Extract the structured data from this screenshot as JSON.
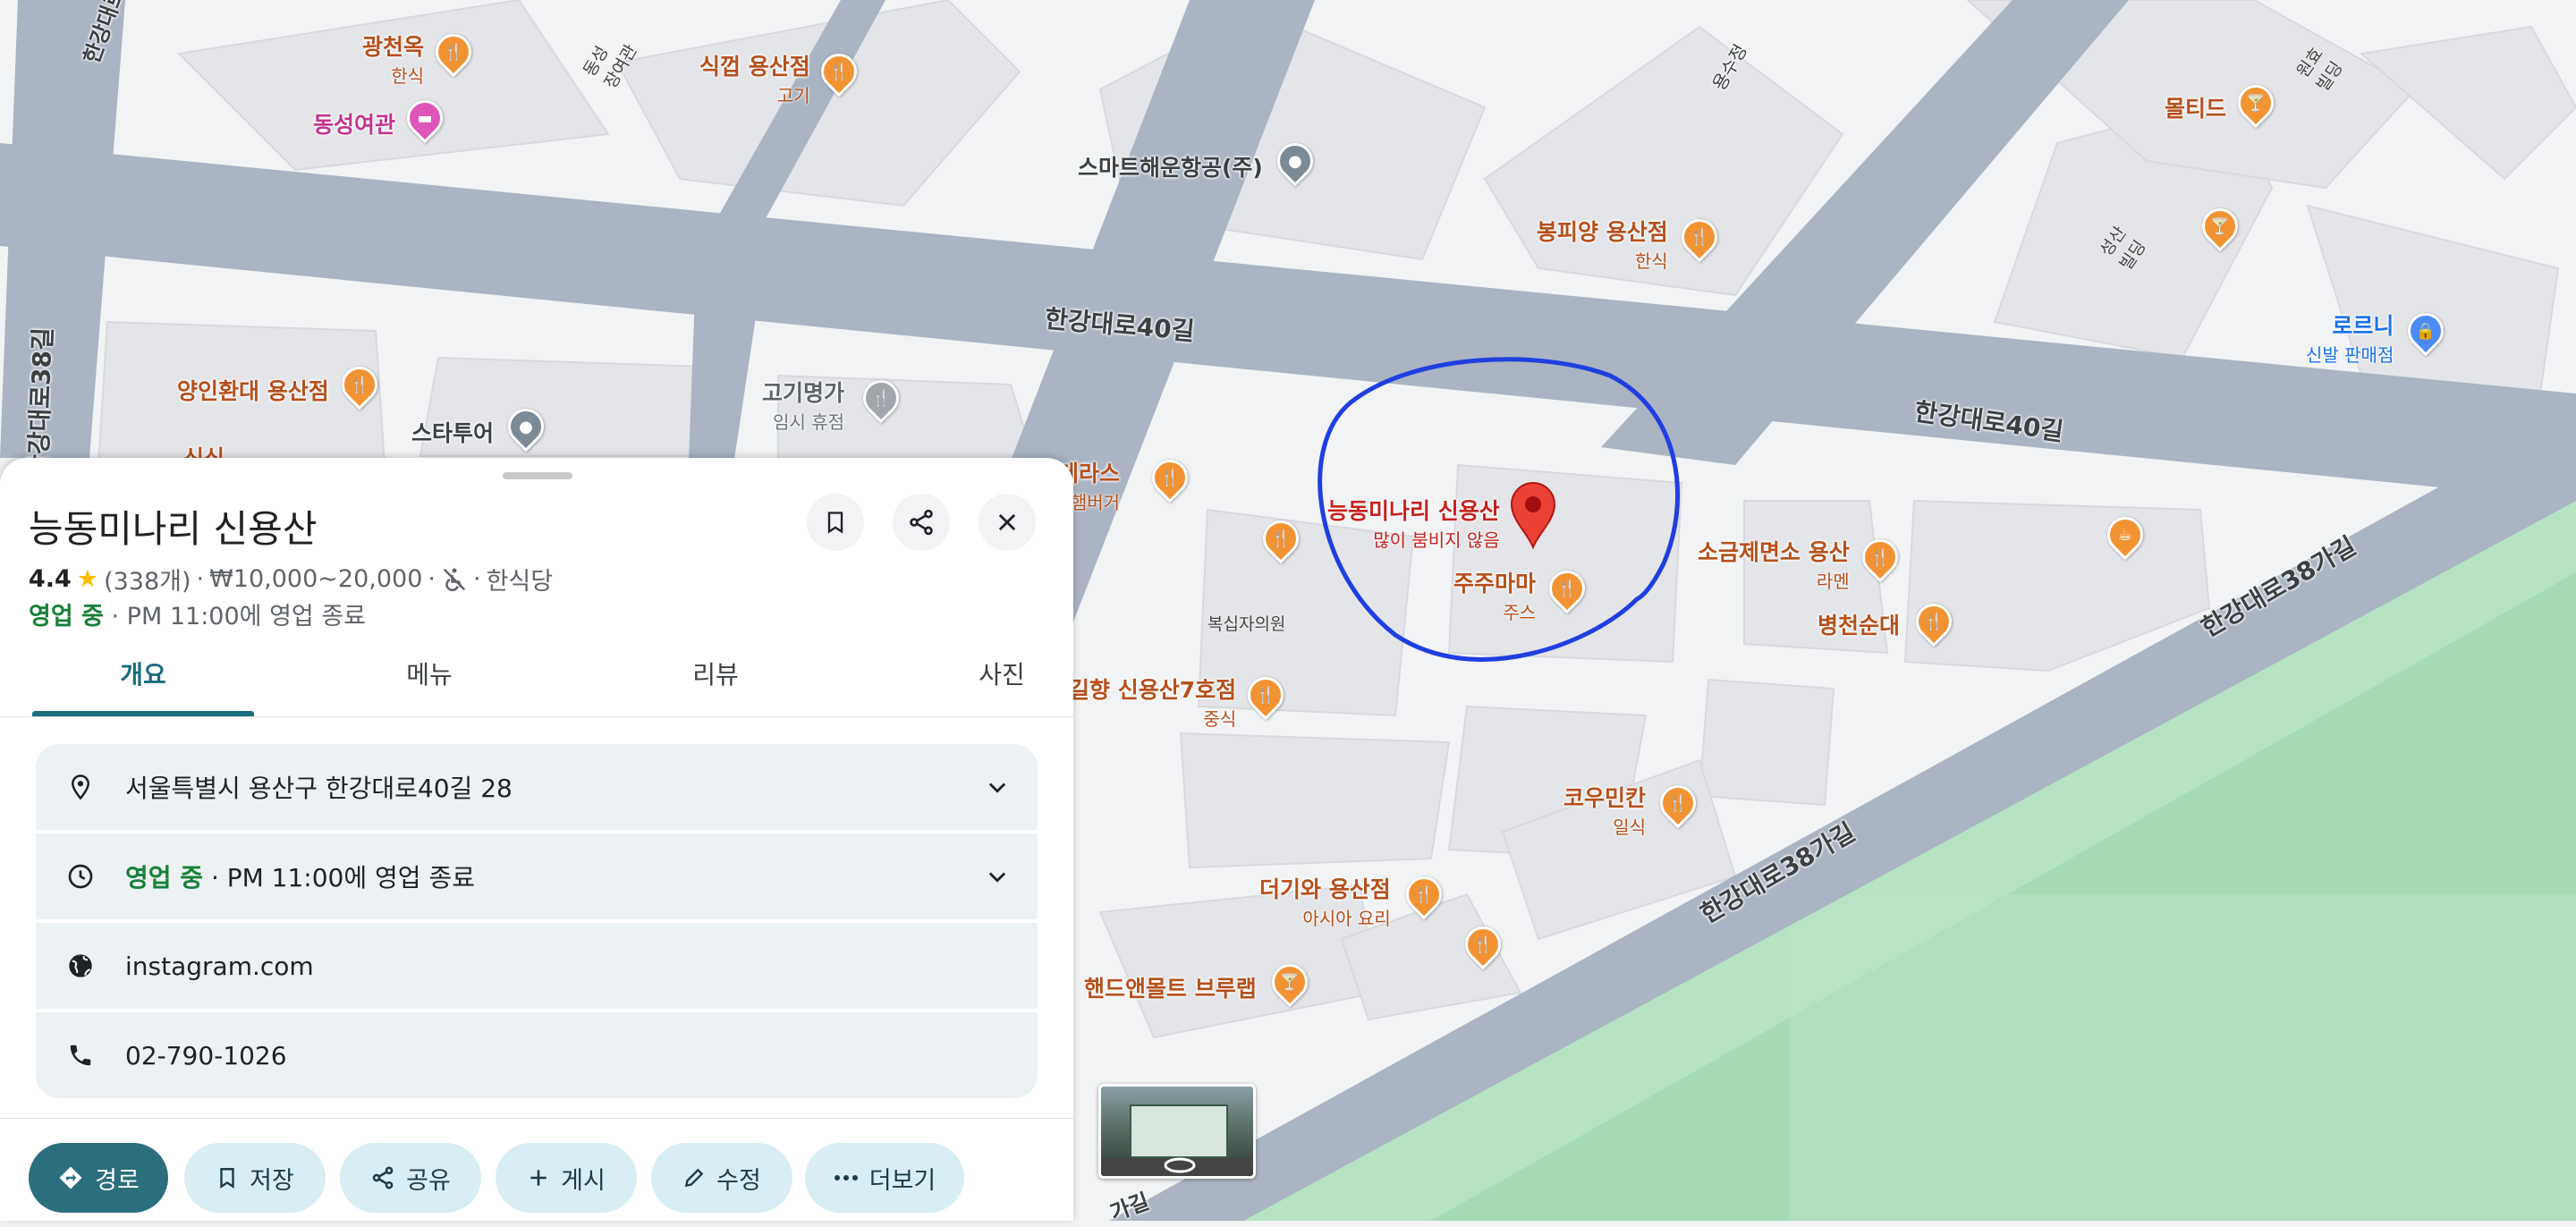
{
  "map": {
    "colors": {
      "road": "#aab4c2",
      "land": "#f1f3f4",
      "block": "#e6e7ea",
      "park": "#b5e3c3",
      "highlight_circle": "#1f3fe0",
      "marker": "#ea4335",
      "food_pin": "#f29333",
      "food_text": "#b5501c"
    },
    "streets": {
      "s1": "한강대로40길",
      "s2": "한강대로40길",
      "s3": "한강대로38가길",
      "s4": "한강대로38가길",
      "s5": "한강대로38길",
      "s6": "한강대로",
      "s7": "가길",
      "s8": "용수정"
    },
    "buildings": {
      "b1": "동성\n장여관",
      "b2": "복십자의원",
      "b3": "성산\n빌딩",
      "b4": "원효\n빌딩"
    },
    "pois": {
      "gwangcheonok": {
        "name": "광천옥",
        "sub": "한식",
        "icon": "fork-knife-icon"
      },
      "dongseong": {
        "name": "동성여관",
        "icon": "bed-icon"
      },
      "sikgyeop": {
        "name": "식껍 용산점",
        "sub": "고기",
        "icon": "fork-knife-icon"
      },
      "smart": {
        "name": "스마트해운항공(주)",
        "icon": "dot-icon"
      },
      "bongpiyang": {
        "name": "봉피양 용산점",
        "sub": "한식",
        "icon": "fork-knife-icon"
      },
      "molteed": {
        "name": "몰티드",
        "icon": "cocktail-icon"
      },
      "rorny": {
        "name": "로르니",
        "sub": "신발 판매점",
        "icon": "shopping-bag-icon"
      },
      "yangin": {
        "name": "양인환대 용산점",
        "icon": "fork-knife-icon"
      },
      "startour": {
        "name": "스타투어",
        "icon": "dot-icon"
      },
      "gogi": {
        "name": "고기명가",
        "sub": "임시 휴점",
        "icon": "fork-knife-icon"
      },
      "baek": {
        "name": "백테라스",
        "sub": "햄버거",
        "icon": "fork-knife-icon"
      },
      "target": {
        "name": "능동미나리 신용산",
        "sub": "많이 붐비지 않음",
        "icon": "location-pin-icon"
      },
      "jujumama": {
        "name": "주주마마",
        "sub": "주스",
        "icon": "fork-knife-icon"
      },
      "sogeum": {
        "name": "소금제면소 용산",
        "sub": "라멘",
        "icon": "fork-knife-icon"
      },
      "byeongcheon": {
        "name": "병천순대",
        "icon": "fork-knife-icon"
      },
      "gilhyang": {
        "name": "길향 신용산7호점",
        "sub": "중식",
        "icon": "fork-knife-icon"
      },
      "koumin": {
        "name": "코우민칸",
        "sub": "일식",
        "icon": "fork-knife-icon"
      },
      "deogi": {
        "name": "더기와 용산점",
        "sub": "아시아 요리",
        "icon": "fork-knife-icon"
      },
      "handand": {
        "name": "핸드앤몰트 브루랩",
        "icon": "cocktail-icon"
      },
      "sinsik": {
        "name": "신식",
        "icon": "fork-knife-icon"
      }
    }
  },
  "place": {
    "name": "능동미나리 신용산",
    "rating": "4.4",
    "star": "★",
    "reviews": "(338개)",
    "price": "₩10,000~20,000",
    "category": "한식당",
    "status": "영업 중",
    "hours_text": "· PM 11:00에 영업 종료",
    "dot": "·"
  },
  "tabs": [
    "개요",
    "메뉴",
    "리뷰",
    "사진"
  ],
  "info": {
    "address": "서울특별시 용산구 한강대로40길 28",
    "hours_status": "영업 중",
    "hours_text": "· PM 11:00에 영업 종료",
    "website": "instagram.com",
    "phone": "02-790-1026"
  },
  "actions": {
    "directions": "경로",
    "save": "저장",
    "share": "공유",
    "post": "게시",
    "edit": "수정",
    "more": "더보기"
  }
}
